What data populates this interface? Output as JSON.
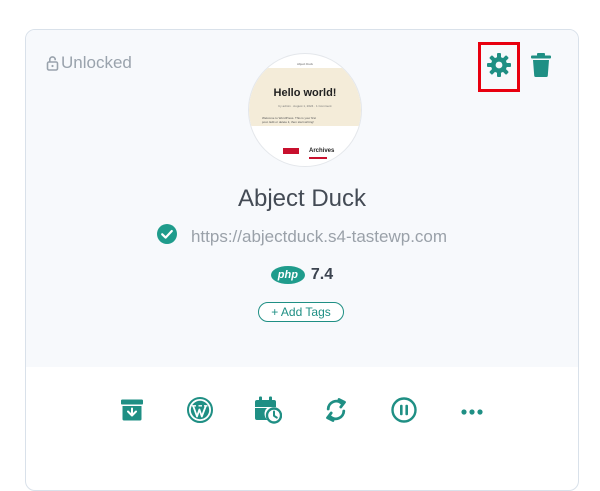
{
  "card": {
    "lock_status": "Unlocked",
    "site_name": "Abject Duck",
    "site_url": "https://abjectduck.s4-tastewp.com",
    "php_label": "php",
    "php_version": "7.4",
    "tags_button": "+ Add Tags"
  },
  "thumbnail": {
    "site_label": "Abject Duck",
    "title": "Hello world!",
    "meta": "by admin · August 1, 2024 · 1 Comment",
    "body": "Welcome to WordPress. This is your first post. Edit or delete it, then start writing!",
    "archives": "Archives"
  },
  "icons": {
    "lock": "lock-open-icon",
    "settings": "gear-icon",
    "delete": "trash-icon",
    "verified": "check-circle-icon",
    "archive": "archive-box-icon",
    "wordpress": "wordpress-icon",
    "schedule": "calendar-clock-icon",
    "sync": "sync-icon",
    "pause": "pause-circle-icon",
    "more": "more-horizontal-icon"
  },
  "colors": {
    "accent": "#1f8f84",
    "highlight": "#e8000f",
    "muted_text": "#9aa1a9"
  }
}
